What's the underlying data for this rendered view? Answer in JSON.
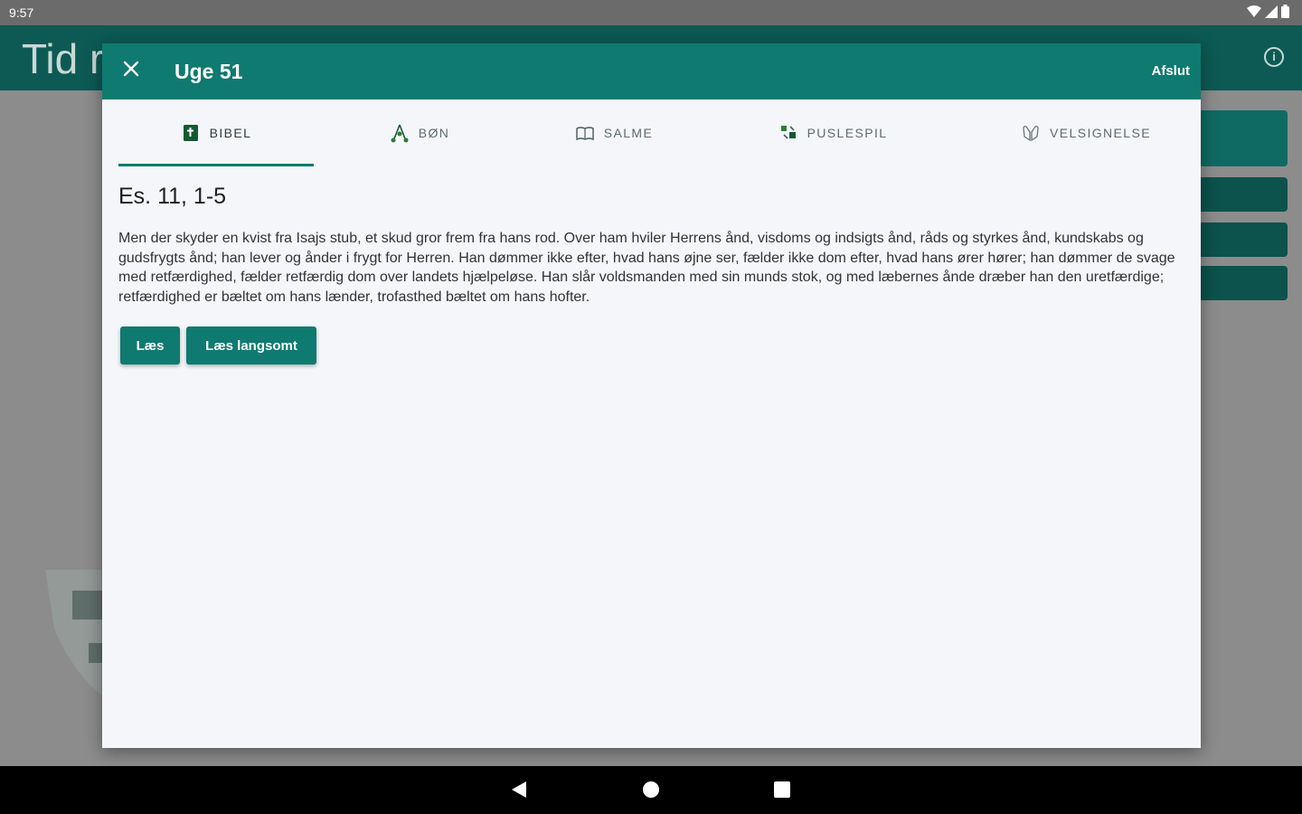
{
  "status_bar": {
    "time": "9:57"
  },
  "background": {
    "app_title": "Tid r",
    "info_icon": "info-icon"
  },
  "dialog": {
    "title": "Uge 51",
    "close_icon": "close-icon",
    "action_label": "Afslut",
    "tabs": [
      {
        "label": "BIBEL",
        "icon": "bible-icon",
        "selected": true
      },
      {
        "label": "BØN",
        "icon": "prayer-icon",
        "selected": false
      },
      {
        "label": "SALME",
        "icon": "hymn-book-icon",
        "selected": false
      },
      {
        "label": "PUSLESPIL",
        "icon": "puzzle-icon",
        "selected": false
      },
      {
        "label": "VELSIGNELSE",
        "icon": "blessing-hands-icon",
        "selected": false
      }
    ],
    "reference": "Es. 11, 1-5",
    "text": "Men der skyder en kvist fra Isajs stub, et skud gror frem fra hans rod. Over ham hviler Herrens ånd, visdoms og indsigts ånd, råds og styrkes ånd, kundskabs og gudsfrygts ånd; han lever og ånder i frygt for Herren. Han dømmer ikke efter, hvad hans øjne ser, fælder ikke dom efter, hvad hans ører hører; han dømmer de svage med retfærdighed, fælder retfærdig dom over landets hjælpeløse. Han slår voldsmanden med sin munds stok, og med læbernes ånde dræber han den uretfærdige; retfærdighed er bæltet om hans lænder, trofasthed bæltet om hans hofter.",
    "buttons": {
      "read": "Læs",
      "read_slow": "Læs langsomt"
    }
  },
  "colors": {
    "primary": "#0f7a70",
    "dialog_bg": "#f4f6fa",
    "scrim": "#8c8c8c"
  }
}
